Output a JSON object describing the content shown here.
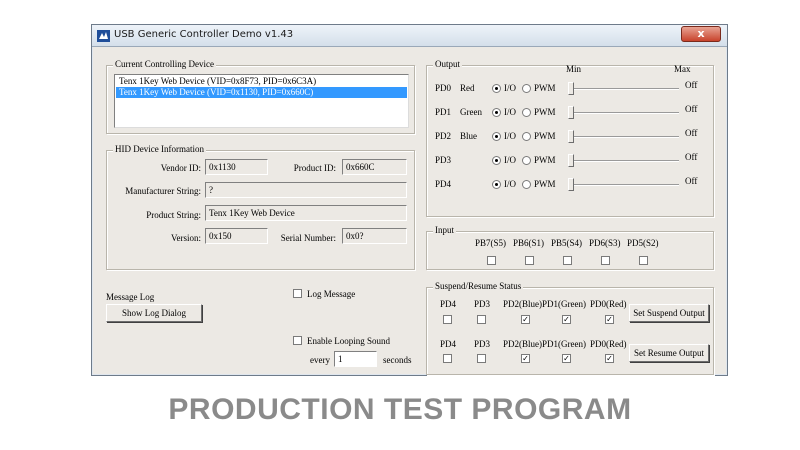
{
  "window": {
    "title": "USB Generic Controller Demo v1.43",
    "close_label": "x"
  },
  "device": {
    "legend": "Current Controlling Device",
    "items": [
      "Tenx 1Key Web Device (VID=0x8F73, PID=0x6C3A)",
      "Tenx 1Key Web Device (VID=0x1130, PID=0x660C)"
    ],
    "selected_index": 1
  },
  "hid": {
    "legend": "HID Device Information",
    "vendor_label": "Vendor ID:",
    "vendor_value": "0x1130",
    "product_id_label": "Product ID:",
    "product_id_value": "0x660C",
    "manufacturer_label": "Manufacturer String:",
    "manufacturer_value": "?",
    "product_string_label": "Product String:",
    "product_string_value": "Tenx 1Key Web Device",
    "version_label": "Version:",
    "version_value": "0x150",
    "serial_label": "Serial Number:",
    "serial_value": "0x0?"
  },
  "log": {
    "label": "Message Log",
    "show_button": "Show Log Dialog",
    "log_message_label": "Log Message",
    "log_message_checked": false,
    "looping_label": "Enable Looping Sound",
    "looping_checked": false,
    "every_label": "every",
    "every_value": "1",
    "seconds_label": "seconds"
  },
  "output": {
    "legend": "Output",
    "min_label": "Min",
    "max_label": "Max",
    "io_label": "I/O",
    "pwm_label": "PWM",
    "rows": [
      {
        "pin": "PD0",
        "color": "Red",
        "mode": "io",
        "state": "Off"
      },
      {
        "pin": "PD1",
        "color": "Green",
        "mode": "io",
        "state": "Off"
      },
      {
        "pin": "PD2",
        "color": "Blue",
        "mode": "io",
        "state": "Off"
      },
      {
        "pin": "PD3",
        "color": "",
        "mode": "io",
        "state": "Off"
      },
      {
        "pin": "PD4",
        "color": "",
        "mode": "io",
        "state": "Off"
      }
    ]
  },
  "input": {
    "legend": "Input",
    "channels": [
      {
        "label": "PB7(S5)",
        "checked": false
      },
      {
        "label": "PB6(S1)",
        "checked": false
      },
      {
        "label": "PB5(S4)",
        "checked": false
      },
      {
        "label": "PD6(S3)",
        "checked": false
      },
      {
        "label": "PD5(S2)",
        "checked": false
      }
    ]
  },
  "suspend": {
    "legend": "Suspend/Resume Status",
    "suspend_row": [
      {
        "label": "PD4",
        "checked": false
      },
      {
        "label": "PD3",
        "checked": false
      },
      {
        "label": "PD2(Blue)",
        "checked": true
      },
      {
        "label": "PD1(Green)",
        "checked": true
      },
      {
        "label": "PD0(Red)",
        "checked": true
      }
    ],
    "resume_row": [
      {
        "label": "PD4",
        "checked": false
      },
      {
        "label": "PD3",
        "checked": false
      },
      {
        "label": "PD2(Blue)",
        "checked": true
      },
      {
        "label": "PD1(Green)",
        "checked": true
      },
      {
        "label": "PD0(Red)",
        "checked": true
      }
    ],
    "set_suspend_label": "Set Suspend Output",
    "set_resume_label": "Set Resume Output"
  },
  "caption": "PRODUCTION TEST PROGRAM"
}
